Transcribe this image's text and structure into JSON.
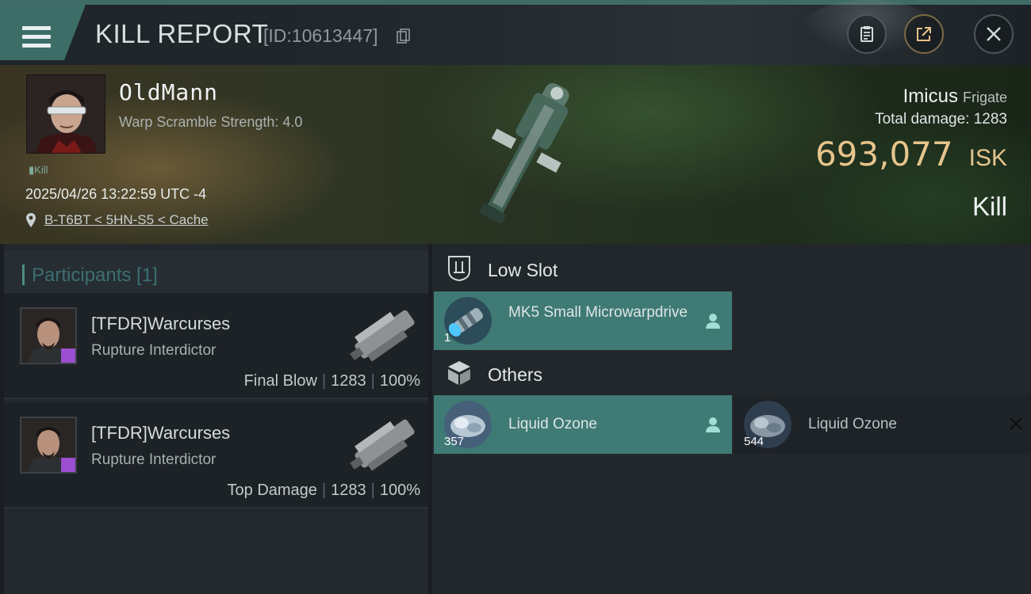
{
  "header": {
    "title": "KILL REPORT",
    "report_id": "[ID:10613447]",
    "icons": [
      "menu-icon",
      "copy-icon",
      "clipboard-icon",
      "share-icon",
      "close-icon"
    ]
  },
  "victim": {
    "name": "OldMann",
    "subtitle": "Warp Scramble Strength: 4.0",
    "tag": "Kill",
    "datetime": "2025/04/26 13:22:59 UTC -4",
    "location": "B-T6BT < 5HN-S5 < Cache",
    "ship_name": "Imicus",
    "ship_class": "Frigate",
    "total_damage_label": "Total damage:",
    "total_damage": "1283",
    "isk_value": "693,077",
    "isk_unit": "ISK",
    "result": "Kill"
  },
  "participants": {
    "title": "Participants [1]",
    "items": [
      {
        "name": "[TFDR]Warcurses",
        "ship": "Rupture Interdictor",
        "role": "Final Blow",
        "damage": "1283",
        "percent": "100%"
      },
      {
        "name": "[TFDR]Warcurses",
        "ship": "Rupture Interdictor",
        "role": "Top Damage",
        "damage": "1283",
        "percent": "100%"
      }
    ]
  },
  "slots": {
    "low_slot": {
      "title": "Low Slot",
      "items": [
        {
          "name": "MK5 Small Microwarpdrive",
          "qty": "1",
          "state": "active"
        }
      ]
    },
    "others": {
      "title": "Others",
      "items": [
        {
          "name": "Liquid Ozone",
          "qty": "357",
          "state": "active"
        },
        {
          "name": "Liquid Ozone",
          "qty": "544",
          "state": "destroyed"
        }
      ]
    }
  },
  "colors": {
    "accent_teal": "#3f7a74",
    "isk_gold": "#e7c48c",
    "corp_badge": "#9b4fd0"
  }
}
